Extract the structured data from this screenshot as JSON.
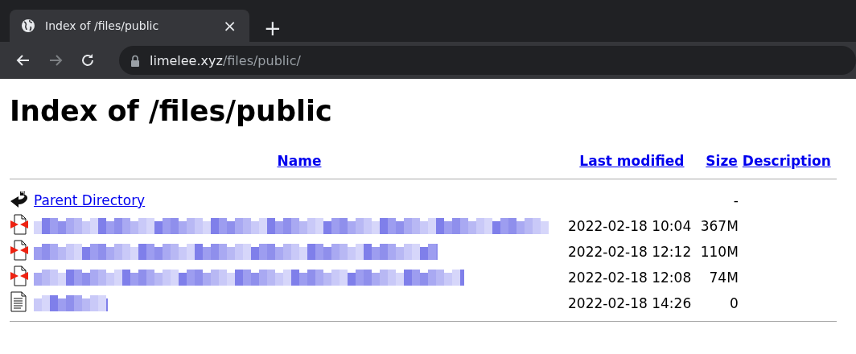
{
  "browser": {
    "tab": {
      "title": "Index of /files/public",
      "selected": true
    },
    "new_tab": "+",
    "close": "×",
    "address": {
      "host": "limelee.xyz",
      "path": "/files/public/"
    }
  },
  "heading": "Index of /files/public",
  "table": {
    "columns": [
      "Name",
      "Last modified",
      "Size",
      "Description"
    ],
    "rows": [
      {
        "kind": "parent",
        "name": "Parent Directory",
        "modified": "",
        "size": "-"
      },
      {
        "kind": "binary",
        "redacted": true,
        "level": 0.97,
        "modified": "2022-02-18 10:04",
        "size": "367M"
      },
      {
        "kind": "binary",
        "redacted": true,
        "level": 0.76,
        "modified": "2022-02-18 12:12",
        "size": "110M"
      },
      {
        "kind": "binary",
        "redacted": true,
        "level": 0.81,
        "modified": "2022-02-18 12:08",
        "size": "74M"
      },
      {
        "kind": "text",
        "redacted": true,
        "level": 0.14,
        "modified": "2022-02-18 14:26",
        "size": "0"
      }
    ]
  }
}
